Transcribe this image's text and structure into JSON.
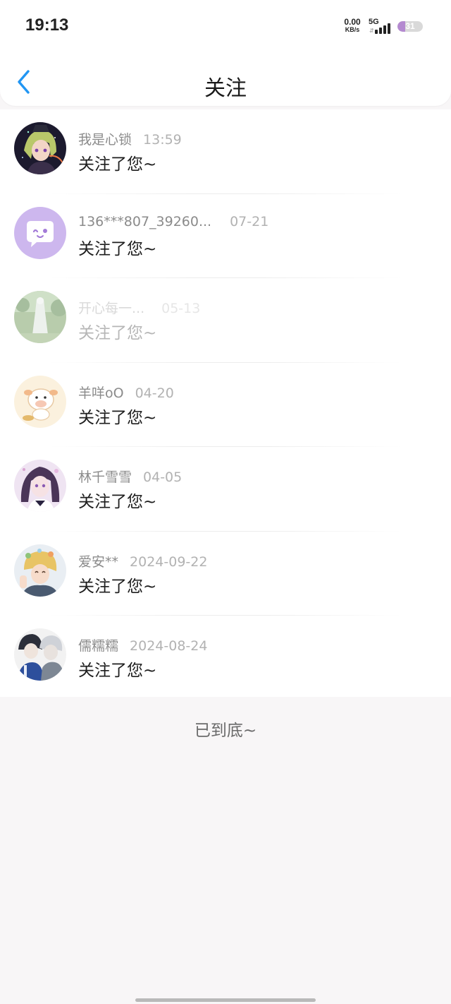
{
  "status_bar": {
    "time": "19:13",
    "net_speed_value": "0.00",
    "net_speed_unit": "KB/s",
    "network_type": "5G",
    "battery": "31",
    "battery_level_percent": 31,
    "battery_accent": "#b48ad0"
  },
  "header": {
    "title": "关注",
    "back_icon": "chevron-left-icon",
    "accent": "#2196f3"
  },
  "items": [
    {
      "name": "我是心锁",
      "time": "13:59",
      "message": "关注了您~",
      "avatar": "anime-avatar-green-hair",
      "faded": false
    },
    {
      "name": "136***807_39260...",
      "time": "07-21",
      "message": "关注了您~",
      "avatar": "chat-bubble-avatar",
      "faded": false
    },
    {
      "name": "开心每一...",
      "time": "05-13",
      "message": "关注了您~",
      "avatar": "statue-photo-avatar",
      "faded": true
    },
    {
      "name": "羊咩oO",
      "time": "04-20",
      "message": "关注了您~",
      "avatar": "cartoon-cow-avatar",
      "faded": false
    },
    {
      "name": "林千雪雪",
      "time": "04-05",
      "message": "关注了您~",
      "avatar": "anime-girl-purple-avatar",
      "faded": false
    },
    {
      "name": "爱安**",
      "time": "2024-09-22",
      "message": "关注了您~",
      "avatar": "anime-blonde-avatar",
      "faded": false
    },
    {
      "name": "儒糯糯",
      "time": "2024-08-24",
      "message": "关注了您~",
      "avatar": "anime-duo-blue-avatar",
      "faded": false
    }
  ],
  "footer": {
    "end_text": "已到底~"
  }
}
